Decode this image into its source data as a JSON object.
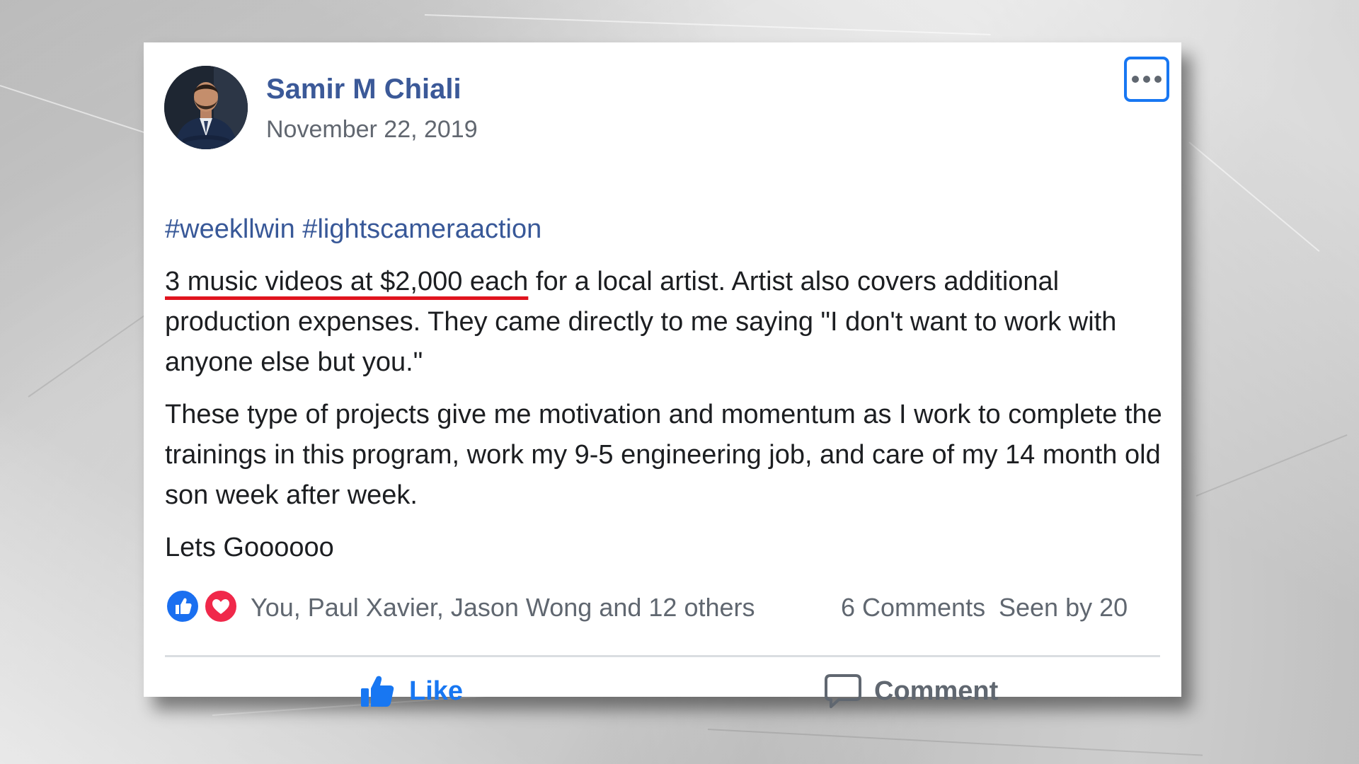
{
  "post": {
    "author": "Samir M Chiali",
    "date": "November 22, 2019",
    "hashtags": "#weekllwin #lightscameraaction",
    "highlight": "3 music videos at $2,000 each",
    "paragraph1_rest": " for a local artist. Artist also covers additional production expenses. They came directly to me saying \"I don't want to work with anyone else but you.\"",
    "paragraph2": "These type of projects give me motivation and momentum as I work to complete the trainings in this program, work my 9-5 engineering job, and care of my 14 month old son week after week.",
    "paragraph3": "Lets Goooooo"
  },
  "reactions": {
    "icons": [
      "like-icon",
      "love-icon"
    ],
    "reactors": "You, Paul Xavier, Jason Wong and 12 others",
    "comments": "6 Comments",
    "seen_by": "Seen by 20"
  },
  "actions": {
    "like_label": "Like",
    "comment_label": "Comment"
  },
  "colors": {
    "accent": "#1877f2",
    "author": "#3b5998",
    "hashtag": "#385898",
    "underline": "#e0141e",
    "like_reaction": "#1a6ff0",
    "love_reaction": "#f0284a"
  }
}
